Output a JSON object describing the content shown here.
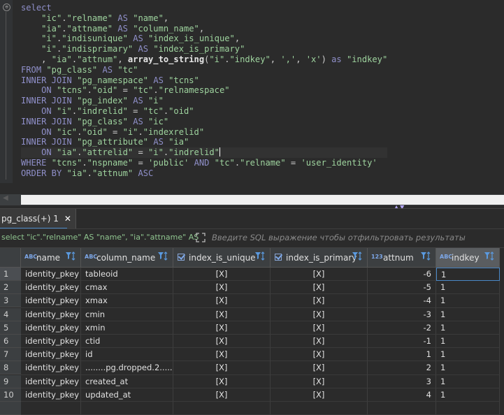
{
  "editor": {
    "fold_symbol": "⊖"
  },
  "tab": {
    "label": "pg_class(+) 1",
    "close": "✕"
  },
  "filter": {
    "sql_preview": "select \"ic\".\"relname\" AS \"name\", \"ia\".\"attname\" AS",
    "placeholder": "Введите SQL выражение чтобы отфильтровать результаты"
  },
  "grid": {
    "columns": [
      {
        "label": "name",
        "type": "text"
      },
      {
        "label": "column_name",
        "type": "text"
      },
      {
        "label": "index_is_unique",
        "type": "bool"
      },
      {
        "label": "index_is_primary",
        "type": "bool"
      },
      {
        "label": "attnum",
        "type": "number"
      },
      {
        "label": "indkey",
        "type": "text"
      }
    ],
    "rows": [
      {
        "n": "1",
        "name": "identity_pkey",
        "column_name": "tableoid",
        "unique": "[X]",
        "primary": "[X]",
        "attnum": "-6",
        "indkey": "1"
      },
      {
        "n": "2",
        "name": "identity_pkey",
        "column_name": "cmax",
        "unique": "[X]",
        "primary": "[X]",
        "attnum": "-5",
        "indkey": "1"
      },
      {
        "n": "3",
        "name": "identity_pkey",
        "column_name": "xmax",
        "unique": "[X]",
        "primary": "[X]",
        "attnum": "-4",
        "indkey": "1"
      },
      {
        "n": "4",
        "name": "identity_pkey",
        "column_name": "cmin",
        "unique": "[X]",
        "primary": "[X]",
        "attnum": "-3",
        "indkey": "1"
      },
      {
        "n": "5",
        "name": "identity_pkey",
        "column_name": "xmin",
        "unique": "[X]",
        "primary": "[X]",
        "attnum": "-2",
        "indkey": "1"
      },
      {
        "n": "6",
        "name": "identity_pkey",
        "column_name": "ctid",
        "unique": "[X]",
        "primary": "[X]",
        "attnum": "-1",
        "indkey": "1"
      },
      {
        "n": "7",
        "name": "identity_pkey",
        "column_name": "id",
        "unique": "[X]",
        "primary": "[X]",
        "attnum": "1",
        "indkey": "1"
      },
      {
        "n": "8",
        "name": "identity_pkey",
        "column_name": "........pg.dropped.2........",
        "unique": "[X]",
        "primary": "[X]",
        "attnum": "2",
        "indkey": "1"
      },
      {
        "n": "9",
        "name": "identity_pkey",
        "column_name": "created_at",
        "unique": "[X]",
        "primary": "[X]",
        "attnum": "3",
        "indkey": "1"
      },
      {
        "n": "10",
        "name": "identity_pkey",
        "column_name": "updated_at",
        "unique": "[X]",
        "primary": "[X]",
        "attnum": "4",
        "indkey": "1"
      }
    ]
  },
  "type_badges": {
    "text": "ABC",
    "number": "123"
  },
  "sql_lines": [
    [
      {
        "t": "k",
        "v": "select"
      }
    ],
    [
      {
        "t": "c",
        "v": "    "
      },
      {
        "t": "s",
        "v": "\"ic\""
      },
      {
        "t": "c",
        "v": "."
      },
      {
        "t": "s",
        "v": "\"relname\""
      },
      {
        "t": "c",
        "v": " "
      },
      {
        "t": "k",
        "v": "AS"
      },
      {
        "t": "c",
        "v": " "
      },
      {
        "t": "s",
        "v": "\"name\""
      },
      {
        "t": "c",
        "v": ","
      }
    ],
    [
      {
        "t": "c",
        "v": "    "
      },
      {
        "t": "s",
        "v": "\"ia\""
      },
      {
        "t": "c",
        "v": "."
      },
      {
        "t": "s",
        "v": "\"attname\""
      },
      {
        "t": "c",
        "v": " "
      },
      {
        "t": "k",
        "v": "AS"
      },
      {
        "t": "c",
        "v": " "
      },
      {
        "t": "s",
        "v": "\"column_name\""
      },
      {
        "t": "c",
        "v": ","
      }
    ],
    [
      {
        "t": "c",
        "v": "    "
      },
      {
        "t": "s",
        "v": "\"i\""
      },
      {
        "t": "c",
        "v": "."
      },
      {
        "t": "s",
        "v": "\"indisunique\""
      },
      {
        "t": "c",
        "v": " "
      },
      {
        "t": "k",
        "v": "AS"
      },
      {
        "t": "c",
        "v": " "
      },
      {
        "t": "s",
        "v": "\"index_is_unique\""
      },
      {
        "t": "c",
        "v": ","
      }
    ],
    [
      {
        "t": "c",
        "v": "    "
      },
      {
        "t": "s",
        "v": "\"i\""
      },
      {
        "t": "c",
        "v": "."
      },
      {
        "t": "s",
        "v": "\"indisprimary\""
      },
      {
        "t": "c",
        "v": " "
      },
      {
        "t": "k",
        "v": "AS"
      },
      {
        "t": "c",
        "v": " "
      },
      {
        "t": "s",
        "v": "\"index_is_primary\""
      }
    ],
    [
      {
        "t": "c",
        "v": "    , "
      },
      {
        "t": "s",
        "v": "\"ia\""
      },
      {
        "t": "c",
        "v": "."
      },
      {
        "t": "s",
        "v": "\"attnum\""
      },
      {
        "t": "c",
        "v": ", "
      },
      {
        "t": "f",
        "v": "array_to_string"
      },
      {
        "t": "c",
        "v": "("
      },
      {
        "t": "s",
        "v": "\"i\""
      },
      {
        "t": "c",
        "v": "."
      },
      {
        "t": "s",
        "v": "\"indkey\""
      },
      {
        "t": "c",
        "v": ", "
      },
      {
        "t": "s",
        "v": "','"
      },
      {
        "t": "c",
        "v": ", "
      },
      {
        "t": "s",
        "v": "'x'"
      },
      {
        "t": "c",
        "v": ") "
      },
      {
        "t": "k",
        "v": "as"
      },
      {
        "t": "c",
        "v": " "
      },
      {
        "t": "s",
        "v": "\"indkey\""
      }
    ],
    [
      {
        "t": "k",
        "v": "FROM"
      },
      {
        "t": "c",
        "v": " "
      },
      {
        "t": "s",
        "v": "\"pg_class\""
      },
      {
        "t": "c",
        "v": " "
      },
      {
        "t": "k",
        "v": "AS"
      },
      {
        "t": "c",
        "v": " "
      },
      {
        "t": "s",
        "v": "\"tc\""
      }
    ],
    [
      {
        "t": "k",
        "v": "INNER JOIN"
      },
      {
        "t": "c",
        "v": " "
      },
      {
        "t": "s",
        "v": "\"pg_namespace\""
      },
      {
        "t": "c",
        "v": " "
      },
      {
        "t": "k",
        "v": "AS"
      },
      {
        "t": "c",
        "v": " "
      },
      {
        "t": "s",
        "v": "\"tcns\""
      }
    ],
    [
      {
        "t": "c",
        "v": "    "
      },
      {
        "t": "k",
        "v": "ON"
      },
      {
        "t": "c",
        "v": " "
      },
      {
        "t": "s",
        "v": "\"tcns\""
      },
      {
        "t": "c",
        "v": "."
      },
      {
        "t": "s",
        "v": "\"oid\""
      },
      {
        "t": "c",
        "v": " = "
      },
      {
        "t": "s",
        "v": "\"tc\""
      },
      {
        "t": "c",
        "v": "."
      },
      {
        "t": "s",
        "v": "\"relnamespace\""
      }
    ],
    [
      {
        "t": "k",
        "v": "INNER JOIN"
      },
      {
        "t": "c",
        "v": " "
      },
      {
        "t": "s",
        "v": "\"pg_index\""
      },
      {
        "t": "c",
        "v": " "
      },
      {
        "t": "k",
        "v": "AS"
      },
      {
        "t": "c",
        "v": " "
      },
      {
        "t": "s",
        "v": "\"i\""
      }
    ],
    [
      {
        "t": "c",
        "v": "    "
      },
      {
        "t": "k",
        "v": "ON"
      },
      {
        "t": "c",
        "v": " "
      },
      {
        "t": "s",
        "v": "\"i\""
      },
      {
        "t": "c",
        "v": "."
      },
      {
        "t": "s",
        "v": "\"indrelid\""
      },
      {
        "t": "c",
        "v": " = "
      },
      {
        "t": "s",
        "v": "\"tc\""
      },
      {
        "t": "c",
        "v": "."
      },
      {
        "t": "s",
        "v": "\"oid\""
      }
    ],
    [
      {
        "t": "k",
        "v": "INNER JOIN"
      },
      {
        "t": "c",
        "v": " "
      },
      {
        "t": "s",
        "v": "\"pg_class\""
      },
      {
        "t": "c",
        "v": " "
      },
      {
        "t": "k",
        "v": "AS"
      },
      {
        "t": "c",
        "v": " "
      },
      {
        "t": "s",
        "v": "\"ic\""
      }
    ],
    [
      {
        "t": "c",
        "v": "    "
      },
      {
        "t": "k",
        "v": "ON"
      },
      {
        "t": "c",
        "v": " "
      },
      {
        "t": "s",
        "v": "\"ic\""
      },
      {
        "t": "c",
        "v": "."
      },
      {
        "t": "s",
        "v": "\"oid\""
      },
      {
        "t": "c",
        "v": " = "
      },
      {
        "t": "s",
        "v": "\"i\""
      },
      {
        "t": "c",
        "v": "."
      },
      {
        "t": "s",
        "v": "\"indexrelid\""
      }
    ],
    [
      {
        "t": "k",
        "v": "INNER JOIN"
      },
      {
        "t": "c",
        "v": " "
      },
      {
        "t": "s",
        "v": "\"pg_attribute\""
      },
      {
        "t": "c",
        "v": " "
      },
      {
        "t": "k",
        "v": "AS"
      },
      {
        "t": "c",
        "v": " "
      },
      {
        "t": "s",
        "v": "\"ia\""
      }
    ],
    [
      {
        "t": "c",
        "v": "    "
      },
      {
        "t": "k",
        "v": "ON"
      },
      {
        "t": "c",
        "v": " "
      },
      {
        "t": "s",
        "v": "\"ia\""
      },
      {
        "t": "c",
        "v": "."
      },
      {
        "t": "s",
        "v": "\"attrelid\""
      },
      {
        "t": "c",
        "v": " = "
      },
      {
        "t": "s",
        "v": "\"i\""
      },
      {
        "t": "c",
        "v": "."
      },
      {
        "t": "s",
        "v": "\"indrelid\""
      }
    ],
    [
      {
        "t": "k",
        "v": "WHERE"
      },
      {
        "t": "c",
        "v": " "
      },
      {
        "t": "s",
        "v": "\"tcns\""
      },
      {
        "t": "c",
        "v": "."
      },
      {
        "t": "s",
        "v": "\"nspname\""
      },
      {
        "t": "c",
        "v": " = "
      },
      {
        "t": "s",
        "v": "'public'"
      },
      {
        "t": "c",
        "v": " "
      },
      {
        "t": "k",
        "v": "AND"
      },
      {
        "t": "c",
        "v": " "
      },
      {
        "t": "s",
        "v": "\"tc\""
      },
      {
        "t": "c",
        "v": "."
      },
      {
        "t": "s",
        "v": "\"relname\""
      },
      {
        "t": "c",
        "v": " = "
      },
      {
        "t": "s",
        "v": "'user_identity'"
      }
    ],
    [
      {
        "t": "k",
        "v": "ORDER BY"
      },
      {
        "t": "c",
        "v": " "
      },
      {
        "t": "s",
        "v": "\"ia\""
      },
      {
        "t": "c",
        "v": "."
      },
      {
        "t": "s",
        "v": "\"attnum\""
      },
      {
        "t": "c",
        "v": " "
      },
      {
        "t": "k",
        "v": "ASC"
      }
    ]
  ]
}
